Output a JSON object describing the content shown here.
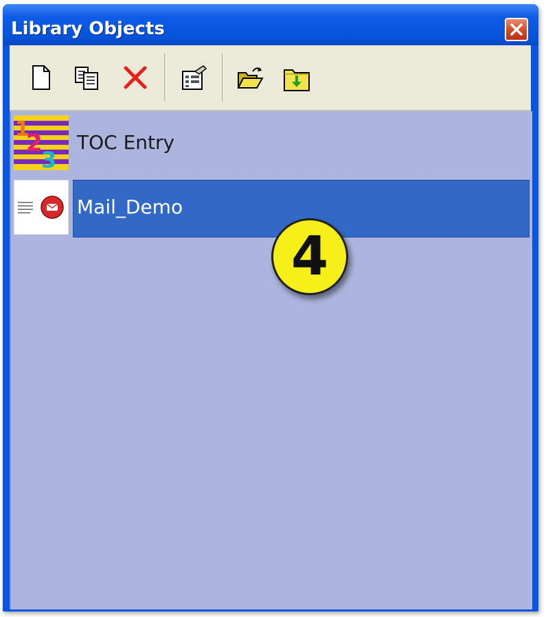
{
  "window": {
    "title": "Library Objects"
  },
  "toolbar": {
    "buttons": [
      {
        "icon": "new-document-icon"
      },
      {
        "icon": "copy-icon"
      },
      {
        "icon": "delete-icon"
      },
      {
        "icon": "properties-icon"
      },
      {
        "icon": "open-folder-icon"
      },
      {
        "icon": "import-folder-icon"
      }
    ]
  },
  "list": {
    "items": [
      {
        "label": "TOC Entry",
        "icon": "toc-entry-thumbnail",
        "selected": false
      },
      {
        "label": "Mail_Demo",
        "icon": "mail-demo-thumbnail",
        "selected": true
      }
    ]
  },
  "callout": {
    "number": "4"
  },
  "colors": {
    "title_bar": "#0a55e0",
    "toolbar_bg": "#ebe9d8",
    "list_bg": "#abb5de",
    "selection": "#3269c7",
    "callout": "#f7ef1a",
    "close_button": "#d24a26"
  }
}
